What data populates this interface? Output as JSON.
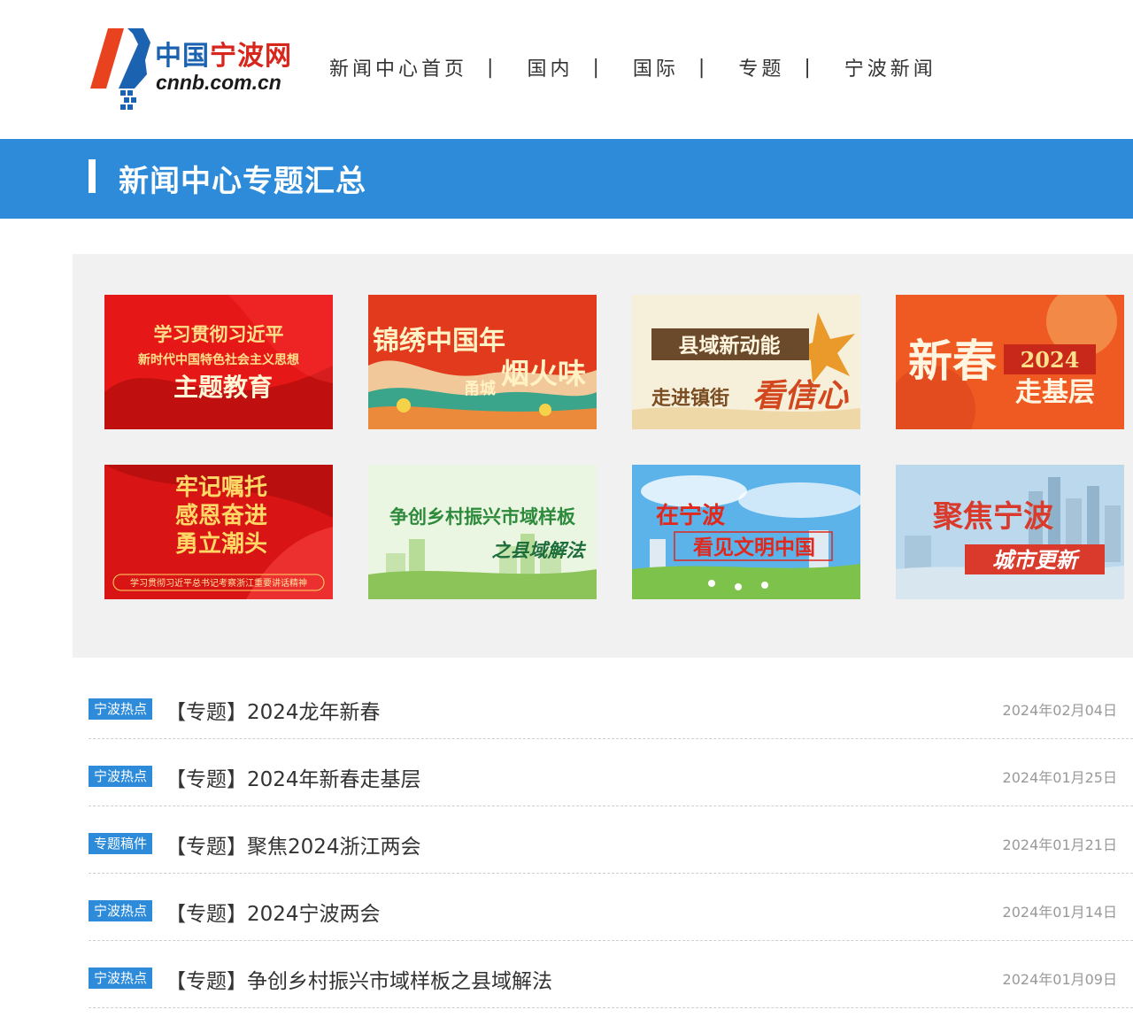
{
  "header": {
    "logo": {
      "cn_text_1": "中国",
      "cn_text_2": "宁波网",
      "en_text": "cnnb.com.cn"
    },
    "nav": [
      "新闻中心首页",
      "国内",
      "国际",
      "专题",
      "宁波新闻"
    ],
    "nav_separator": "|"
  },
  "banner": {
    "title": "新闻中心专题汇总"
  },
  "topics": [
    {
      "lines": [
        "学习贯彻习近平",
        "新时代中国特色社会主义思想",
        "主题教育"
      ],
      "palette": [
        "#e51717",
        "#b10d0d"
      ]
    },
    {
      "lines": [
        "锦绣中国年",
        "甬城",
        "烟火味"
      ],
      "palette": [
        "#e23a1c",
        "#f1c89a"
      ]
    },
    {
      "lines": [
        "县域新动能",
        "走进镇街",
        "看信心"
      ],
      "palette": [
        "#f6efd9",
        "#6b4a2b"
      ]
    },
    {
      "lines": [
        "新春",
        "2024",
        "走基层"
      ],
      "palette": [
        "#ef5a23",
        "#f7b86a"
      ]
    },
    {
      "lines": [
        "牢记嘱托",
        "感恩奋进",
        "勇立潮头",
        "学习贯彻习近平总书记考察浙江重要讲话精神"
      ],
      "palette": [
        "#d81414",
        "#a50c0c"
      ]
    },
    {
      "lines": [
        "争创乡村振兴市域样板",
        "之县域解法"
      ],
      "palette": [
        "#eaf6e2",
        "#8cc45a"
      ]
    },
    {
      "lines": [
        "在宁波",
        "看见文明中国"
      ],
      "palette": [
        "#5cb3ea",
        "#7dc24a"
      ]
    },
    {
      "lines": [
        "聚焦宁波",
        "城市更新"
      ],
      "palette": [
        "#bcd8ec",
        "#d93a2b"
      ]
    }
  ],
  "list": [
    {
      "tag": "宁波热点",
      "title": "【专题】2024龙年新春",
      "date": "2024年02月04日"
    },
    {
      "tag": "宁波热点",
      "title": "【专题】2024年新春走基层",
      "date": "2024年01月25日"
    },
    {
      "tag": "专题稿件",
      "title": "【专题】聚焦2024浙江两会",
      "date": "2024年01月21日"
    },
    {
      "tag": "宁波热点",
      "title": "【专题】2024宁波两会",
      "date": "2024年01月14日"
    },
    {
      "tag": "宁波热点",
      "title": "【专题】争创乡村振兴市域样板之县域解法",
      "date": "2024年01月09日"
    }
  ]
}
